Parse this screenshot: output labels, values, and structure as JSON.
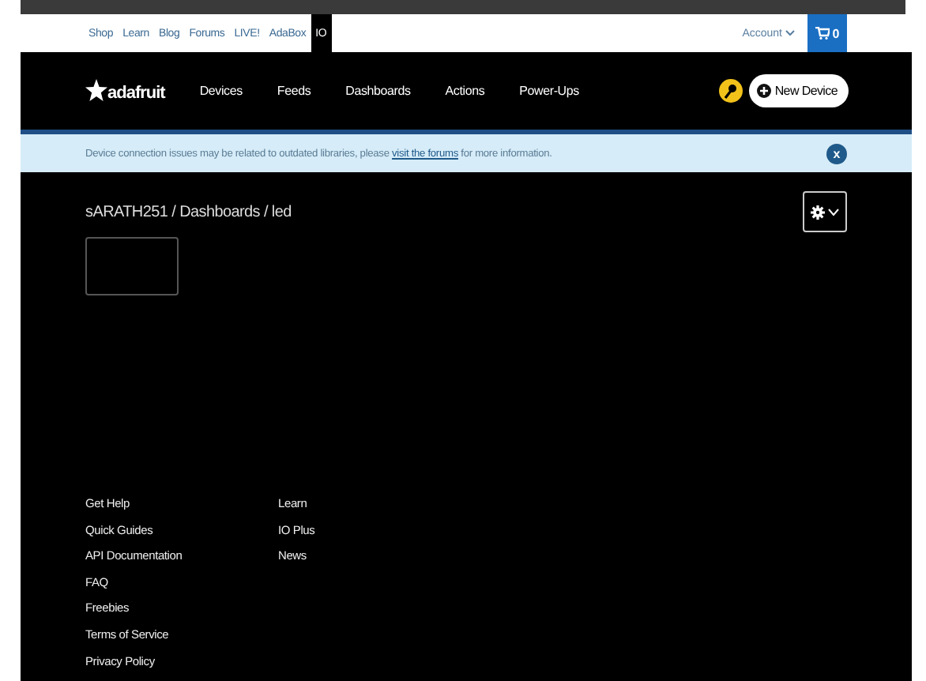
{
  "top_links": [
    {
      "label": "Shop",
      "selected": false
    },
    {
      "label": "Learn",
      "selected": false
    },
    {
      "label": "Blog",
      "selected": false
    },
    {
      "label": "Forums",
      "selected": false
    },
    {
      "label": "LIVE!",
      "selected": false
    },
    {
      "label": "AdaBox",
      "selected": false
    },
    {
      "label": "IO",
      "selected": true
    }
  ],
  "account": "Account",
  "cart_count": "0",
  "logo_text": "adafruit",
  "nav": [
    "Devices",
    "Feeds",
    "Dashboards",
    "Actions",
    "Power-Ups"
  ],
  "new_device": "New Device",
  "banner": {
    "before": "Device connection issues may be related to outdated libraries, please",
    "link": "visit the forums",
    "after": "for more information.",
    "close": "x"
  },
  "breadcrumb": "sARATH251 / Dashboards / led",
  "footer_col_1": [
    "Get Help",
    "Quick Guides",
    "API Documentation",
    "FAQ",
    "Freebies",
    "Terms of Service",
    "Privacy Policy"
  ],
  "footer_col_2": [
    "Learn",
    "IO Plus",
    "News"
  ]
}
